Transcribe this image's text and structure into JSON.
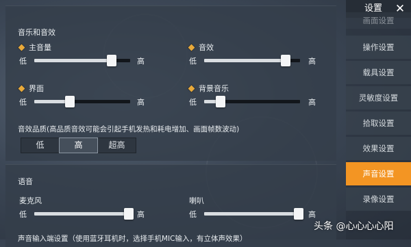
{
  "music": {
    "section_title": "音乐和音效",
    "low": "低",
    "high": "高",
    "sliders": [
      {
        "label": "主音量",
        "value": 0.81
      },
      {
        "label": "音效",
        "value": 0.85
      },
      {
        "label": "界面",
        "value": 0.37
      },
      {
        "label": "背景音乐",
        "value": 0.17
      }
    ],
    "quality_note": "音效品质(高品质音效可能会引起手机发热和耗电增加、画面帧数波动)",
    "quality_options": [
      "低",
      "高",
      "超高"
    ],
    "quality_selected": "高"
  },
  "voice": {
    "section_title": "语音",
    "low": "低",
    "high": "高",
    "sliders": [
      {
        "label": "麦克风",
        "value": 1.0
      },
      {
        "label": "喇叭",
        "value": 1.0
      }
    ],
    "cut_text": "声音输入端设置（使用蓝牙耳机时，选择手机MIC输入，有立体声效果）"
  },
  "sidebar": {
    "title": "设置",
    "items": [
      {
        "label": "画面设置"
      },
      {
        "label": "操作设置"
      },
      {
        "label": "载具设置"
      },
      {
        "label": "灵敏度设置"
      },
      {
        "label": "拾取设置"
      },
      {
        "label": "效果设置"
      },
      {
        "label": "声音设置"
      },
      {
        "label": "录像设置"
      }
    ],
    "active_index": 6
  },
  "watermark": "头条 @心心心心阳",
  "colors": {
    "accent": "#f39523",
    "diamond": "#e8a93a"
  }
}
